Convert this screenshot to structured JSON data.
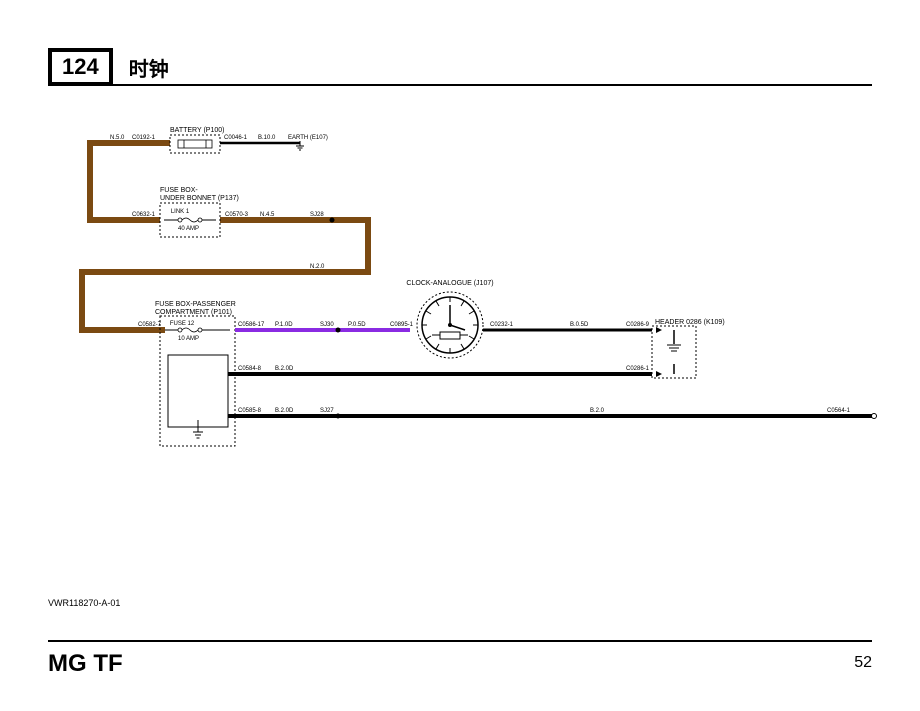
{
  "header": {
    "page_badge": "124",
    "title": "时钟"
  },
  "components": {
    "battery": {
      "label": "BATTERY (P100)"
    },
    "fusebox_bonnet": {
      "label": "FUSE BOX-\nUNDER BONNET (P137)",
      "link_label": "LINK 1",
      "rating": "40 AMP"
    },
    "fusebox_passenger": {
      "label": "FUSE BOX-PASSENGER\nCOMPARTMENT (P101)",
      "fuse_label": "FUSE 12",
      "rating": "10 AMP"
    },
    "clock": {
      "label": "CLOCK-ANALOGUE (J107)"
    },
    "header0286": {
      "label": "HEADER 0286 (K109)"
    },
    "earth": {
      "label": "EARTH (E107)"
    }
  },
  "wires": {
    "w_n50": "N.5.0",
    "w_b100": "B.10.0",
    "w_n45": "N.4.5",
    "w_n20": "N.2.0",
    "w_p10d": "P.1.0D",
    "w_p05d": "P.0.5D",
    "w_b20d_a": "B.2.0D",
    "w_b20d_b": "B.2.0D",
    "w_b05d": "B.0.5D",
    "w_b20": "B.2.0"
  },
  "connectors": {
    "c0192_1": "C0192-1",
    "c0046_1": "C0046-1",
    "c0632_1": "C0632-1",
    "c0570_3": "C0570-3",
    "c0582_7": "C0582-7",
    "c0586_17": "C0586-17",
    "c0895_1": "C0895-1",
    "c0232_1": "C0232-1",
    "c0286_9": "C0286-9",
    "c0584_8": "C0584-8",
    "c0286_1": "C0286-1",
    "c0585_8": "C0585-8",
    "c0564_1": "C0564-1"
  },
  "splices": {
    "sj28": "SJ28",
    "sj30": "SJ30",
    "sj27": "SJ27"
  },
  "doc_id": "VWR118270-A-01",
  "footer": {
    "model": "MG TF",
    "page_no": "52"
  }
}
